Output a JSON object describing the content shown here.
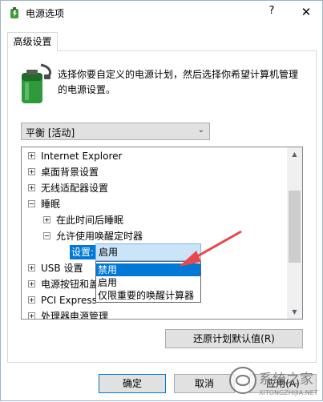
{
  "window": {
    "title": "电源选项",
    "help": "?",
    "close": "✕"
  },
  "tab": {
    "label": "高级设置"
  },
  "description": "选择你要自定义的电源计划，然后选择你希望计算机管理的电源设置。",
  "plan_select": {
    "value": "平衡 [活动]",
    "arrow": "⌄"
  },
  "tree": {
    "items": [
      {
        "label": "Internet Explorer",
        "expander": "plus"
      },
      {
        "label": "桌面背景设置",
        "expander": "plus"
      },
      {
        "label": "无线适配器设置",
        "expander": "plus"
      },
      {
        "label": "睡眠",
        "expander": "minus"
      },
      {
        "label": "在此时间后睡眠",
        "expander": "plus"
      },
      {
        "label": "允许使用唤醒定时器",
        "expander": "minus"
      },
      {
        "label": "USB 设置",
        "expander": "plus"
      },
      {
        "label": "电源按钮和盖",
        "expander": "plus"
      },
      {
        "label": "PCI Express",
        "expander": "plus"
      },
      {
        "label": "处理器电源管理",
        "expander": "plus"
      }
    ],
    "setting_label": "设置:",
    "setting_value": "启用",
    "dropdown_options": [
      "禁用",
      "启用",
      "仅限重要的唤醒计算器"
    ],
    "selected_option": "禁用"
  },
  "scroll": {
    "up": "▲",
    "down": "▼"
  },
  "buttons": {
    "restore": "还原计划默认值(R)",
    "ok": "确定",
    "cancel": "取消",
    "apply": "应用(A)"
  },
  "watermark": {
    "text": "系统之家",
    "url": "XITONGZHIJIA.NET"
  },
  "colors": {
    "selection": "#0078d7",
    "arrow": "#e8474c",
    "combo_bg": "#cce4f7"
  }
}
